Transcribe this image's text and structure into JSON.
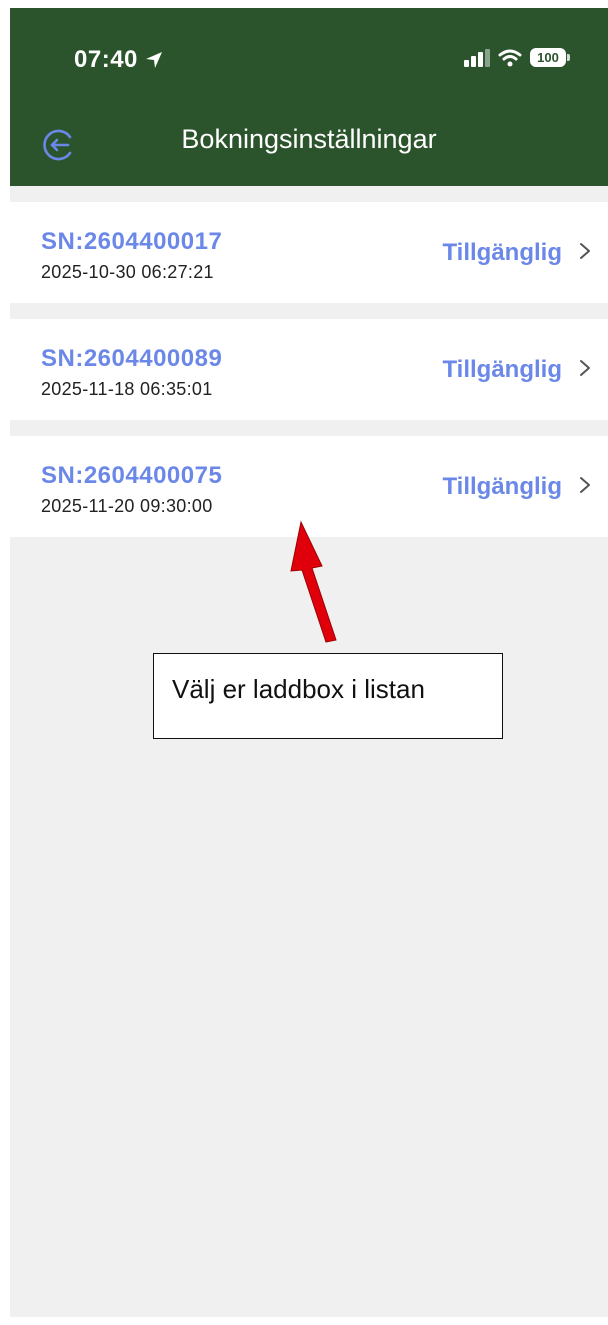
{
  "status_bar": {
    "time": "07:40",
    "battery": "100"
  },
  "header": {
    "title": "Bokningsinställningar"
  },
  "chargers": [
    {
      "sn": "SN:2604400017",
      "date": "2025-10-30 06:27:21",
      "status": "Tillgänglig"
    },
    {
      "sn": "SN:2604400089",
      "date": "2025-11-18 06:35:01",
      "status": "Tillgänglig"
    },
    {
      "sn": "SN:2604400075",
      "date": "2025-11-20 09:30:00",
      "status": "Tillgänglig"
    }
  ],
  "annotation": {
    "text": "Välj er laddbox i listan"
  },
  "colors": {
    "header_bg": "#2b542d",
    "accent": "#6b88e8",
    "page_bg": "#f0f0f0",
    "arrow": "#e0000b"
  }
}
